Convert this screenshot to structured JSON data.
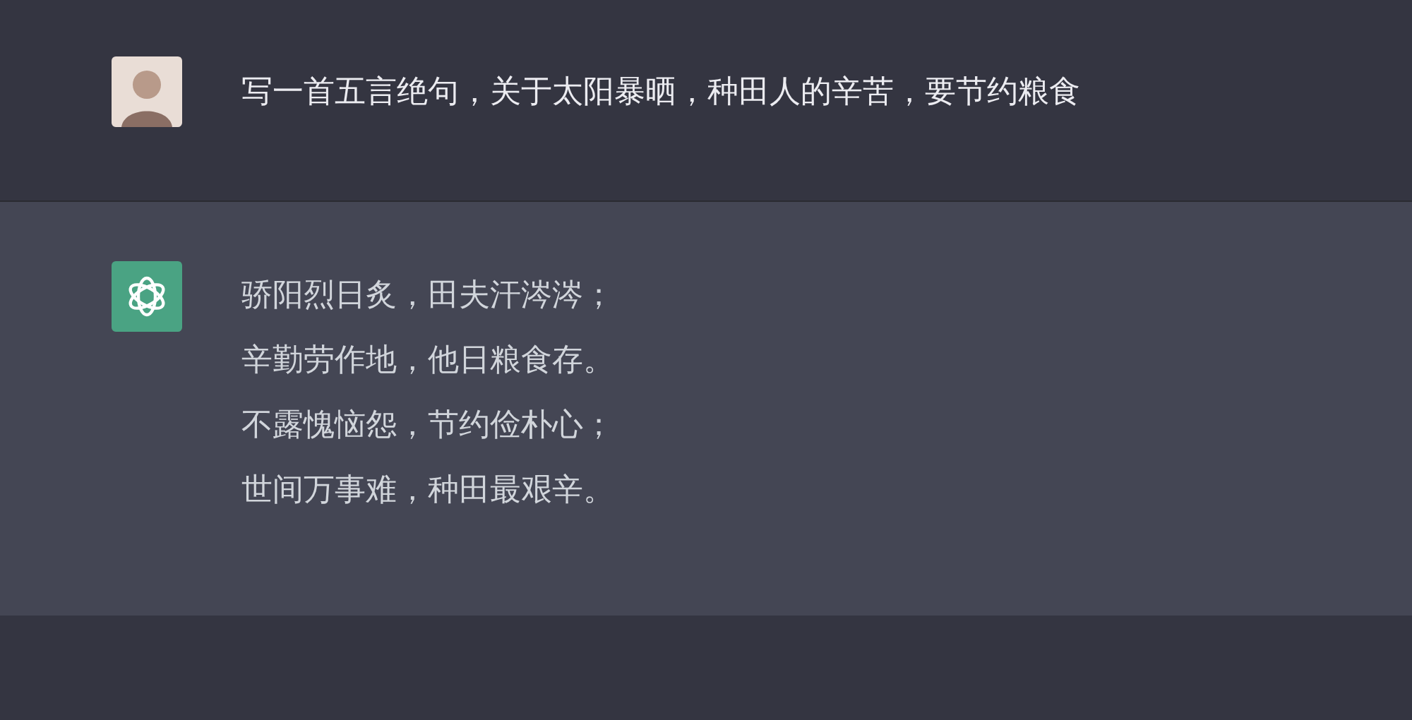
{
  "messages": [
    {
      "kind": "user",
      "lines": [
        "写一首五言绝句，关于太阳暴晒，种田人的辛苦，要节约粮食"
      ]
    },
    {
      "kind": "assistant",
      "lines": [
        "骄阳烈日炙，田夫汗涔涔；",
        "辛勤劳作地，他日粮食存。",
        "不露愧恼怨，节约俭朴心；",
        "世间万事难，种田最艰辛。"
      ]
    }
  ]
}
